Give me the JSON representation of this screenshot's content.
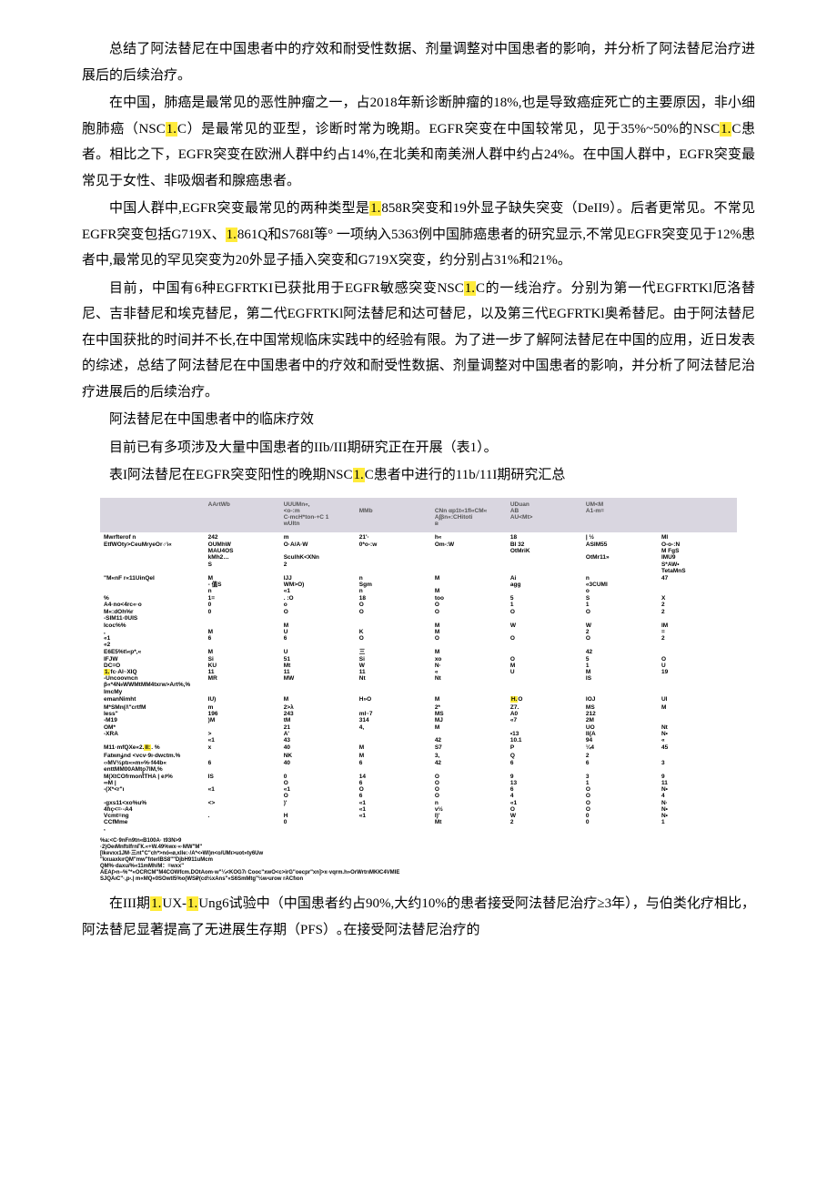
{
  "paragraphs": {
    "p1a": "总结了阿法替尼在中国患者中的疗效和耐受性数据、剂量调整对中国患者的影响，并分析了阿法替尼治疗进展后的后续治疗。",
    "p2_pre": "在中国，肺癌是最常见的恶性肿瘤之一，占2018年新诊断肿瘤的18%,也是导致癌症死亡的主要原因，非小细胞肺癌（NSC",
    "p2_hl1": "1.",
    "p2_mid1": "C）是最常见的亚型，诊断时常为晚期。EGFR突变在中国较常见，见于35%~50%的NSC",
    "p2_hl2": "1.",
    "p2_mid2": "C患者。相比之下，EGFR突变在欧洲人群中约占14%,在北美和南美洲人群中约占24%。在中国人群中，EGFR突变最常见于女性、非吸烟者和腺癌患者。",
    "p3_pre": "中国人群中,EGFR突变最常见的两种类型是",
    "p3_hl1": "1.",
    "p3_mid1": "858R突变和19外显子缺失突变（DeII9）。后者更常见。不常见EGFR突变包括G719X、",
    "p3_hl2": "1.",
    "p3_mid2": "861Q和S768I等°  一项纳入5363例中国肺癌患者的研究显示,不常见EGFR突变见于12%患者中,最常见的罕见突变为20外显子插入突变和G719X突变，约分别占31%和21%。",
    "p4_pre": "目前，中国有6种EGFRTKI已获批用于EGFR敏感突变NSC",
    "p4_hl1": "1.",
    "p4_mid1": "C的一线治疗。分别为第一代EGFRTKl厄洛替尼、吉非替尼和埃克替尼，第二代EGFRTKl阿法替尼和达可替尼，以及第三代EGFRTKl奥希替尼。由于阿法替尼在中国获批的时间并不长,在中国常规临床实践中的经验有限。为了进一步了解阿法替尼在中国的应用，近日发表的综述，总结了阿法替尼在中国患者中的疗效和耐受性数据、剂量调整对中国患者的影响，并分析了阿法替尼治疗进展后的后续治疗。",
    "p5": "阿法替尼在中国患者中的临床疗效",
    "p6": "目前已有多项涉及大量中国患者的IIb/III期研究正在开展（表1）。",
    "p7_pre": "表I阿法替尼在EGFR突变阳性的晚期NSC",
    "p7_hl": "1.",
    "p7_post": "C患者中进行的11b/11I期研究汇总",
    "p8_pre": "在III期",
    "p8_hl1": "1.",
    "p8_mid1": "UX-",
    "p8_hl2": "1.",
    "p8_mid2": "Ung6试验中（中国患者约占90%,大约10%的患者接受阿法替尼治疗≥3年），与伯类化疗相比，阿法替尼显著提高了无进展生存期（PFS）｡在接受阿法替尼治疗的"
  },
  "table": {
    "headers": [
      "",
      "AArtWb",
      "UUUMn«,",
      "",
      "",
      "UDuan",
      "UM<M"
    ],
    "subheaders": [
      "",
      "",
      "<o-:m\nC-mcH*ton-+C 1\nwUItn",
      "MMb",
      "CNn αp1t«1fI«CM«\nA∫βn«:CHitoti\nв",
      "AB\nAU<Mt>",
      "A1-m="
    ],
    "rows": [
      [
        "Mwrfterof       n",
        "242",
        "m",
        "21'·",
        "h«",
        "18",
        "| ½",
        "MI"
      ],
      [
        "EtfWOty>CeuMryeOr♂\\«",
        "OUMhW\nMAU4OS\nkMh2…\nS",
        "O·A/A·W\n\nSculhK<XNn\n2",
        "0*o-:w",
        "Om-:W",
        "BI 32\nOtMriK",
        "ASIM55\n\nOtMr11»",
        "O-o-:N\nM FgS\nIMU9\nS*AW•\nTetaMnS"
      ],
      [
        "\"M«nF r«11UinQeI",
        "M\n-   值S\nn",
        "IJJ\nWM>O)\n«1",
        "n\nSgm\nn",
        "M\n\nM",
        "Ai\nagg",
        "n\n«3CUMI\no",
        "47"
      ],
      [
        "                 %\n   A4·no<4rc«·o\n   M«:dOh%r\n  -SIM11·0UIS",
        "1=\n0\n0",
        ". :O\no\nO",
        "18\nO\nO",
        "too\nO\nO",
        "5\n1\nO",
        "S\n1\nO",
        "X\n2\n2"
      ],
      [
        "Icoc%%\n,\n«1\n«2",
        "\nM\n6",
        "M\nU\n6",
        "\nK\nO",
        "M\nM\nO",
        "W\n\nO",
        "W\n2\nO",
        "IM\n=\n2"
      ],
      [
        "E6E5%t\\«p*,«\n   IFJW\n   DC=O\n   1.fc·Aŀ·XIQ\n -Uncoovncn\nβ«*4№WWMtMM4txrw>Art%,%",
        "M\nSi\nKU\n11\nMR",
        "U\n51\nMt\n11\nMW",
        "三\nSi\nW\n11\nNt",
        "M\nxo\nN·\n«\nNt",
        "\nO\nM\nU",
        "42\n5\n1\nM\nIS",
        "\nO\nU\n19"
      ],
      [
        "ImcMy",
        "",
        "",
        "",
        "",
        "",
        "",
        ""
      ],
      [
        "emanNimht",
        "IU)",
        "M",
        "H»O",
        "M",
        "H.O",
        "IOJ",
        "Ul"
      ],
      [
        "M*SMn(/\\\"crtfM\n   Iess\"\n  -M19",
        "m\n196\n)M",
        "2>λ\n243\ntM",
        "\nmŀ·7\n314",
        "2*\nMS\nMJ",
        "Z7.\nA0\n«7",
        "MS\n212\n2M",
        "M"
      ],
      [
        "            OM*\n  -XRA",
        "\n>\n«1",
        "21\nA'\n43",
        "4,",
        "M\n\n42",
        "\n•13\n10.1",
        "UO\nII{A\n94",
        "Nt\nN•\n«"
      ],
      [
        "M11·mfQXe«2.II:. %",
        "x",
        "40",
        "M",
        "S7",
        "P",
        "¼4",
        "45"
      ],
      [
        "Fatwnۈnd <vcv·9ı·dwctm.%",
        "",
        "NK",
        "M",
        "3,",
        "Q",
        "2",
        ""
      ],
      [
        "            ‹›MV½ptı«»m»%·f44b«\nenttMM00AMto7IM,%",
        "6",
        "40",
        "6",
        "42",
        "6",
        "6",
        "3"
      ],
      [
        "M(XtCOfrmon۠۠tTHA | e۶%\n ∞M |\n -(X*<r\"ı\n\n    -gxs11<xo%u%\n    4fıç<=·-A4\n    Vcmt=ng\n       CCfMme\n  ,",
        "IS\n\n«1\n\n<>\n\n.",
        "0\nO\n«1\nO\n)'\n\nH\n0",
        "14\n6\nO\n6\n«1\n«1\n«1",
        "O\nO\nO\nO\nn\nv½\nI)'\nMt",
        "9\n13\n6\n4\n«1\nO\nW\n2",
        "3\n1\nO\nO\nO\nO\n0\n0",
        "9\n11\nN•\n4\nN·\nN•\nN•\n1"
      ]
    ],
    "footnotes": [
      "%a:<C·9nFn9tn«B100A·         t93N>9",
      "·2)OeıMnftıIfrnГК.«+W.49%wx·«·MW\"M\"",
      "[Ikevxx1JM·三nt\"C\"ch*>nó«ø,xlle:·/A*<•WI)n<o/UMı>uot»ty6Uw",
      "\"kxuaxkırQM\"mw\"fıterIBS8\"\"DjbH911uMcm",
      "QM%·daxu/%«11mMh/M：=wxx\"",
      "AEA∫>n−%\"*«OCRCM\"M4COWfcm.DOtAom·w\"¼<KOG7ı                 Cooc\"xwO<c>irG\"oecpr\"xn]>x·vqrm.h»OrWrtrıMKłC4VMIE",
      "SJQAıC\"·,pۥ.| m«MQ«0SOwtl5%o(WS₽(cd½xAns\"«S6SmMtg\"½wۥurow                                                               rACfıon"
    ]
  }
}
